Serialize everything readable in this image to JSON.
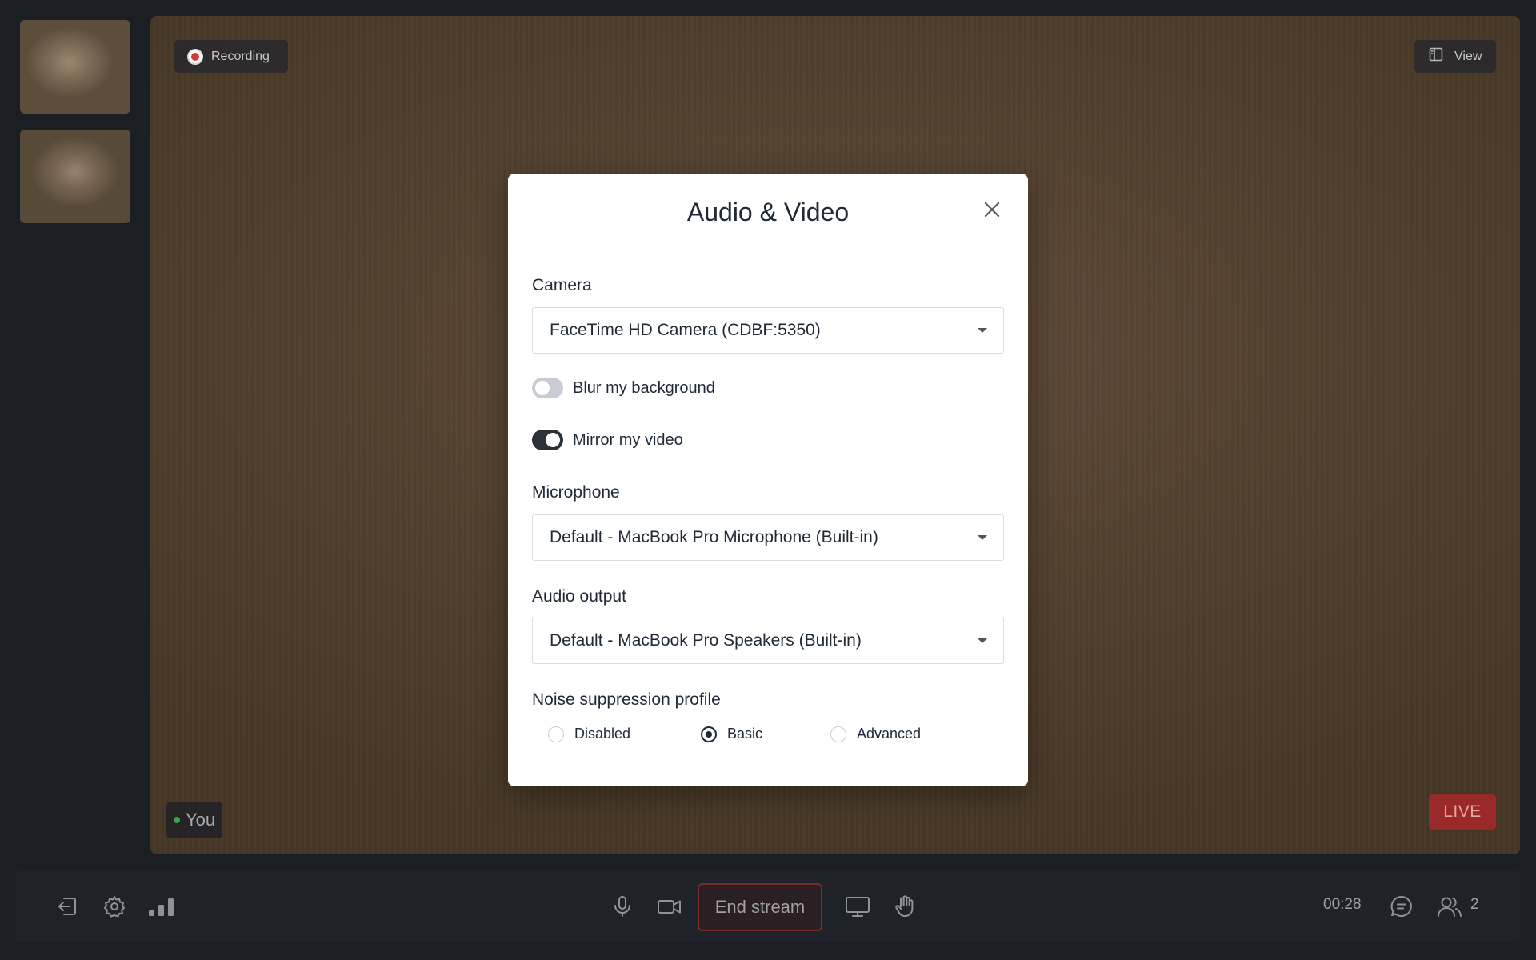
{
  "stage": {
    "recording_label": "Recording",
    "view_label": "View",
    "self_label": "You",
    "live_label": "LIVE"
  },
  "modal": {
    "title": "Audio & Video",
    "camera": {
      "label": "Camera",
      "value": "FaceTime HD Camera (CDBF:5350)"
    },
    "blur_background": {
      "label": "Blur my background",
      "on": false
    },
    "mirror_video": {
      "label": "Mirror my video",
      "on": true
    },
    "microphone": {
      "label": "Microphone",
      "value": "Default - MacBook Pro Microphone (Built-in)"
    },
    "audio_output": {
      "label": "Audio output",
      "value": "Default - MacBook Pro Speakers (Built-in)"
    },
    "noise_suppression": {
      "label": "Noise suppression profile",
      "options": [
        "Disabled",
        "Basic",
        "Advanced"
      ],
      "selected": "Basic"
    }
  },
  "toolbar": {
    "end_stream_label": "End stream",
    "timer": "00:28",
    "participant_count": "2"
  },
  "colors": {
    "live": "#9a2a29",
    "end_stream_border": "#7a2a2a",
    "online_dot": "#2fa84f"
  }
}
